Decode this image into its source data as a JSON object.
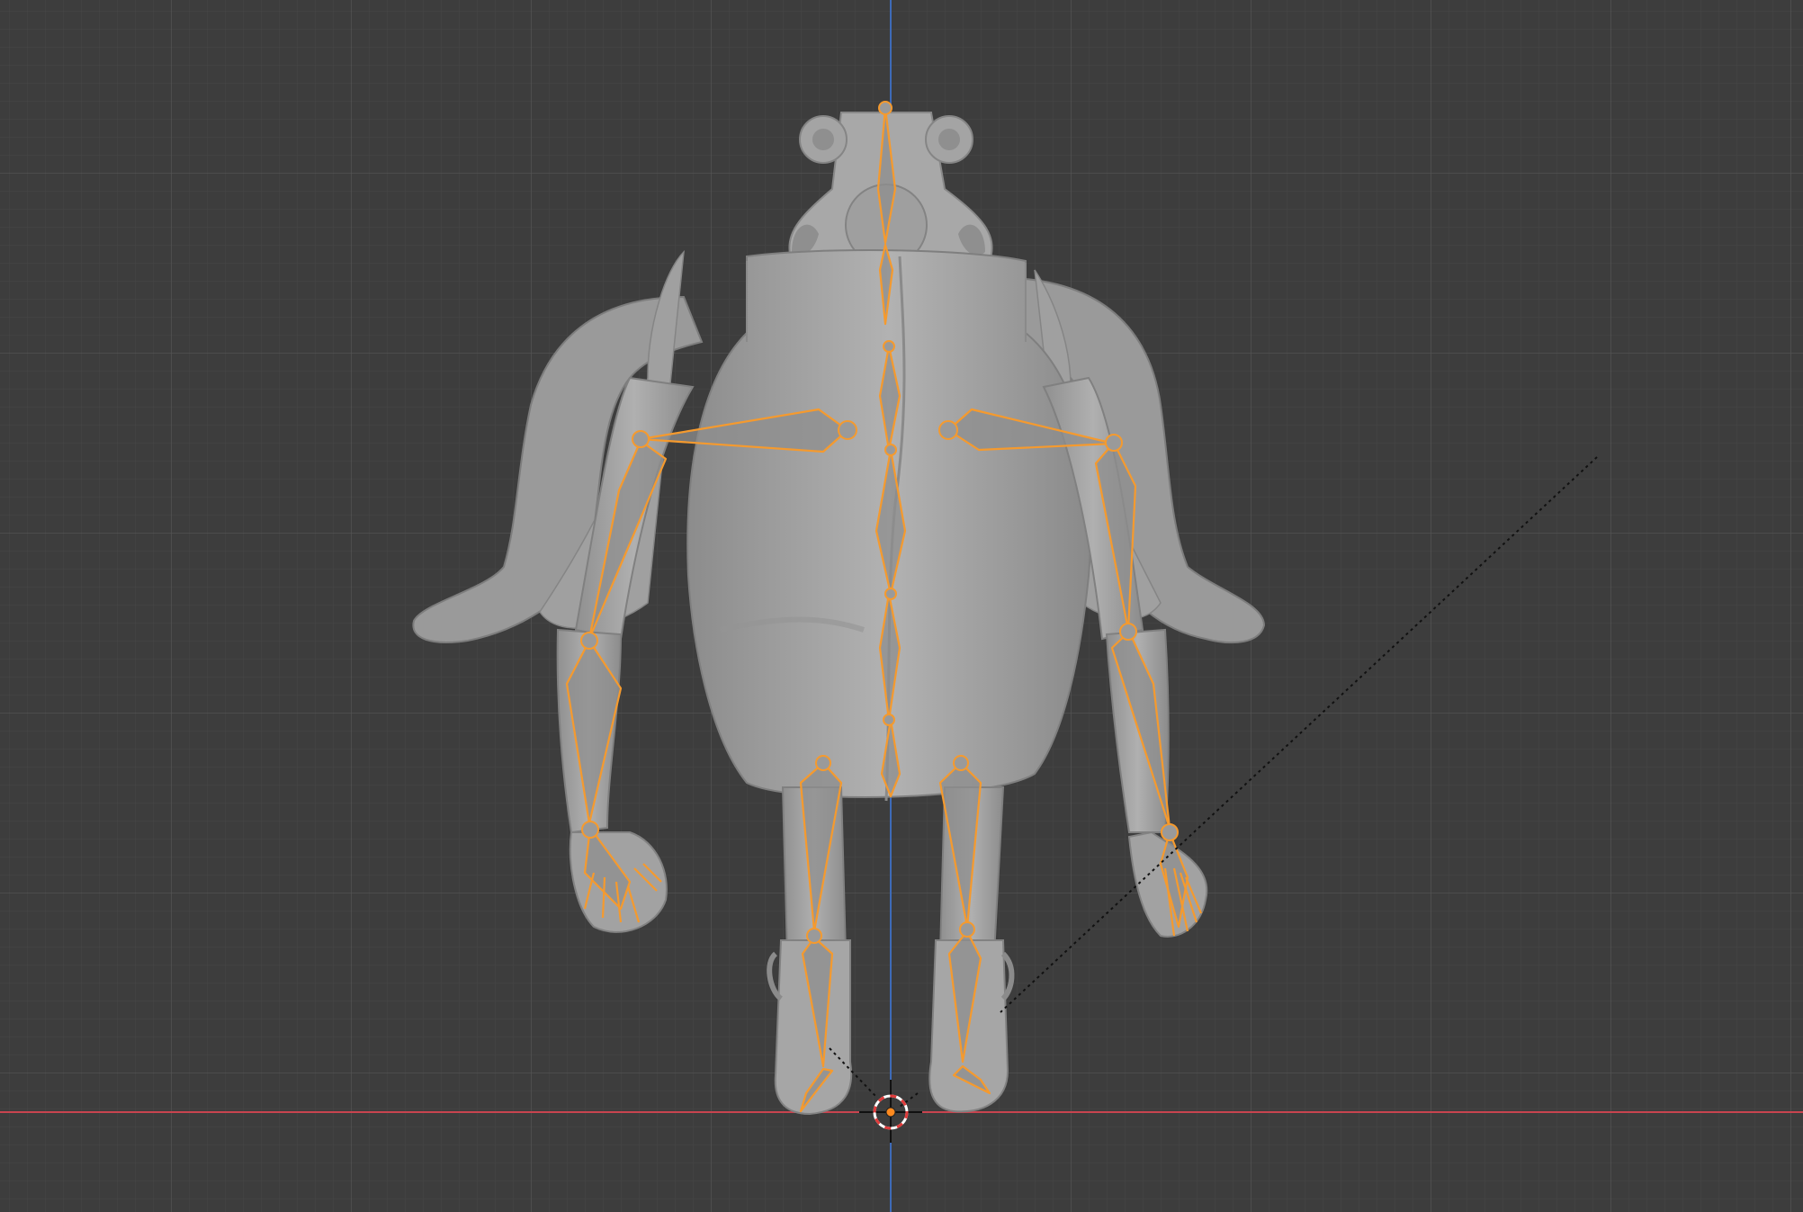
{
  "viewport": {
    "background": "#3d3d3d",
    "grid_minor_color": "#474747",
    "grid_major_color": "#545454",
    "x_axis_color": "#c8444f",
    "z_axis_color": "#3e6bb8"
  },
  "scene": {
    "mesh_color": "#a9a9a9",
    "mesh_shadow_color": "#7a7a7a",
    "armature_color": "#f59a2e",
    "bone_fill_color": "#8e8e8e",
    "origin_color": "#ff8a1f",
    "cursor_ring_colors": [
      "#e03a3a",
      "#ffffff"
    ]
  },
  "icons": [
    "3d-cursor-icon",
    "object-origin-icon"
  ]
}
